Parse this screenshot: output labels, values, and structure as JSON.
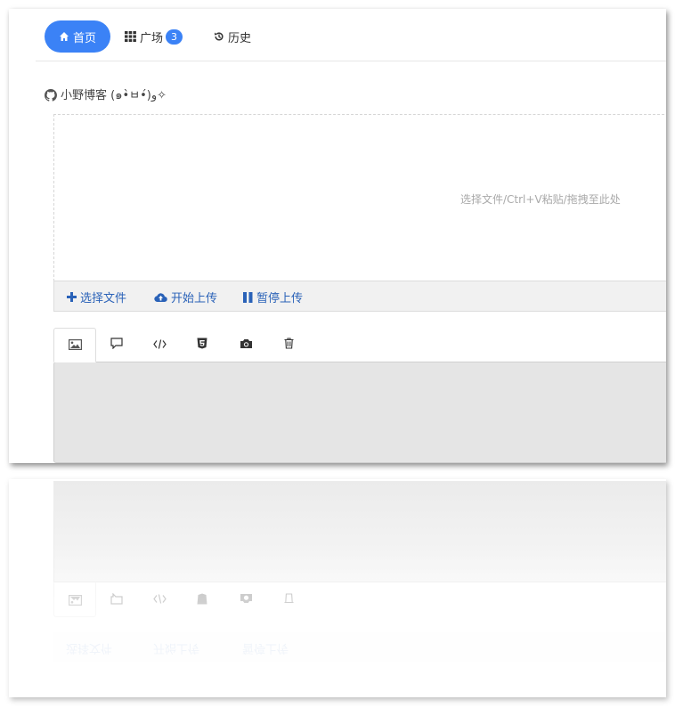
{
  "nav": {
    "home_label": "首页",
    "plaza_label": "广场",
    "plaza_badge": "3",
    "history_label": "历史"
  },
  "blog": {
    "title": "小野博客 (๑•̀ㅂ•́)و✧"
  },
  "dropzone": {
    "hint": "选择文件/Ctrl+V粘贴/拖拽至此处"
  },
  "upload_bar": {
    "select_label": "选择文件",
    "start_label": "开始上传",
    "pause_label": "暂停上传"
  },
  "tabs": [
    {
      "icon": "image-icon"
    },
    {
      "icon": "comment-icon"
    },
    {
      "icon": "code-icon"
    },
    {
      "icon": "html5-icon"
    },
    {
      "icon": "camera-icon"
    },
    {
      "icon": "trash-icon"
    }
  ],
  "colors": {
    "accent": "#3b82f6",
    "link": "#2a62b8",
    "panel": "#e5e5e5"
  }
}
